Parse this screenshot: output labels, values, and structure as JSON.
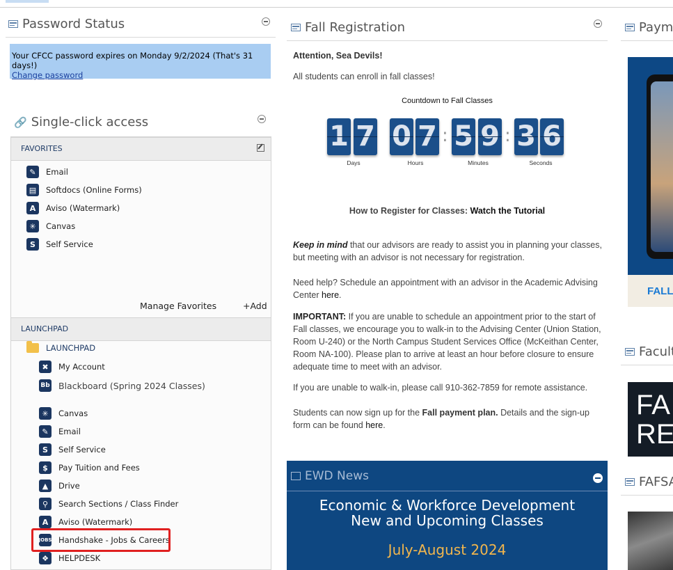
{
  "password_status": {
    "title": "Password Status",
    "message": "Your CFCC password expires on Monday 9/2/2024 (That's 31 days!)",
    "change_link": "Change password"
  },
  "single_click": {
    "title": "Single-click access",
    "favorites": {
      "header": "FAVORITES",
      "items": [
        {
          "label": "Email",
          "icon": "email-icon"
        },
        {
          "label": "Softdocs (Online Forms)",
          "icon": "forms-icon"
        },
        {
          "label": "Aviso (Watermark)",
          "icon": "aviso-icon"
        },
        {
          "label": "Canvas",
          "icon": "canvas-icon"
        },
        {
          "label": "Self Service",
          "icon": "self-service-icon"
        }
      ],
      "manage": "Manage Favorites",
      "add": "+Add"
    },
    "launchpad": {
      "header": "LAUNCHPAD",
      "folder": "LAUNCHPAD",
      "items": [
        {
          "label": "My Account",
          "icon": "account-icon"
        },
        {
          "label": "Blackboard (Spring 2024 Classes)",
          "icon": "blackboard-icon"
        },
        {
          "label": "Canvas",
          "icon": "canvas-icon"
        },
        {
          "label": "Email",
          "icon": "email-icon"
        },
        {
          "label": "Self Service",
          "icon": "self-service-icon"
        },
        {
          "label": "Pay Tuition and Fees",
          "icon": "dollar-icon"
        },
        {
          "label": "Drive",
          "icon": "drive-icon"
        },
        {
          "label": "Search Sections / Class Finder",
          "icon": "search-icon"
        },
        {
          "label": "Aviso (Watermark)",
          "icon": "aviso-icon"
        },
        {
          "label": "Handshake - Jobs & Careers",
          "icon": "jobs-icon"
        },
        {
          "label": "HELPDESK",
          "icon": "helpdesk-icon"
        }
      ]
    }
  },
  "fall_registration": {
    "title": "Fall Registration",
    "attention": "Attention, Sea Devils!",
    "enroll": "All students can enroll in fall classes!",
    "countdown_title": "Countdown to Fall Classes",
    "countdown": {
      "days": [
        "1",
        "7"
      ],
      "hours": [
        "0",
        "7"
      ],
      "minutes": [
        "5",
        "9"
      ],
      "seconds": [
        "3",
        "6"
      ],
      "labels": {
        "days": "Days",
        "hours": "Hours",
        "minutes": "Minutes",
        "seconds": "Seconds"
      }
    },
    "how_to": "How to Register for Classes:",
    "tutorial": "Watch the Tutorial",
    "keep_bold": "Keep in mind",
    "keep_rest": " that our advisors are ready to assist you in planning your classes, but meeting with an advisor is not necessary for registration.",
    "need_help": "Need help? Schedule an appointment with an advisor in the Academic Advising Center ",
    "here": "here",
    "important_bold": "IMPORTANT:",
    "important_rest": " If you are unable to schedule an appointment prior to the start of Fall classes, we encourage you to walk-in to the Advising Center (Union Station, Room U-240) or the North Campus Student Services Office (McKeithan Center, Room NA-100). Please plan to arrive at least an hour before closure to ensure adequate time to meet with an advisor.",
    "walkin": "If you are unable to walk-in, please call 910-362-7859 for remote assistance.",
    "payment_pre": "Students can now sign up for the ",
    "payment_bold": "Fall payment plan.",
    "payment_post": " Details and the sign-up form can be found ",
    "payment_here": "here",
    "period": "."
  },
  "ewd_news": {
    "title": "EWD News",
    "line1": "Economic & Workforce Development",
    "line2": "New and Upcoming Classes",
    "date": "July-August 2024"
  },
  "right_col": {
    "payment_title": "Payme",
    "fall_text": "FALL",
    "faculty_title": "Facult",
    "fa_text": "FA",
    "re_text": "RE",
    "fafsa_title": "FAFSA"
  },
  "colors": {
    "accent": "#1b4f8a",
    "highlight": "#e02020",
    "pw_bg": "#a9cdf2"
  }
}
